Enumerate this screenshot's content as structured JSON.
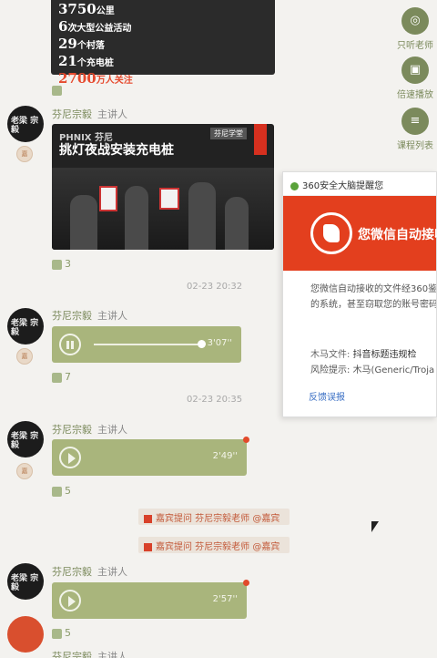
{
  "top_card": {
    "lines": [
      {
        "num": "3750",
        "unit": "公里",
        "red": false
      },
      {
        "num": "6",
        "unit": "次大型公益活动",
        "red": false
      },
      {
        "num": "29",
        "unit": "个村落",
        "red": false
      },
      {
        "num": "21",
        "unit": "个充电桩",
        "red": false
      },
      {
        "num": "2700",
        "unit": "万人关注",
        "red": true
      }
    ]
  },
  "lecturer": {
    "name": "芬尼宗毅",
    "role": "主讲人",
    "avatar_text": "老梁 宗毅",
    "badge": "嘉"
  },
  "video_card": {
    "tag": "PHNIX 芬尼",
    "headline": "挑灯夜战安装充电桩",
    "logo": "芬尼学堂"
  },
  "likes": {
    "l1": "",
    "l2": "3",
    "l3": "7",
    "l4": "5",
    "l5": "5"
  },
  "timestamps": {
    "t1": "02-23 20:32",
    "t2": "02-23 20:35"
  },
  "audio": [
    {
      "duration": "3'07''",
      "state": "playing"
    },
    {
      "duration": "2'49''",
      "state": "paused"
    },
    {
      "duration": "2'57''",
      "state": "paused"
    }
  ],
  "right_panel": [
    {
      "label": "只听老师",
      "icon": "headphones-icon",
      "glyph": "◎"
    },
    {
      "label": "倍速播放",
      "icon": "speed-icon",
      "glyph": "▣"
    },
    {
      "label": "课程列表",
      "icon": "list-icon",
      "glyph": "≡"
    }
  ],
  "popup": {
    "title": "360安全大脑提醒您",
    "banner_text": "您微信自动接收",
    "body_line1": "您微信自动接收的文件经360鉴",
    "body_line2": "的系统，甚至窃取您的账号密码",
    "file_label": "木马文件:",
    "file_value": "抖音标题违规检",
    "risk_label": "风险提示:",
    "risk_value": "木马(Generic/Troja",
    "report_link": "反馈误报"
  },
  "red_lines": [
    {
      "text": "嘉宾提问 芬尼宗毅老师 @嘉宾"
    },
    {
      "text": "嘉宾提问 芬尼宗毅老师 @嘉宾"
    }
  ],
  "colors": {
    "accent": "#a9b57c",
    "brand_red": "#e33f1e",
    "bg": "#f3f2ef"
  }
}
